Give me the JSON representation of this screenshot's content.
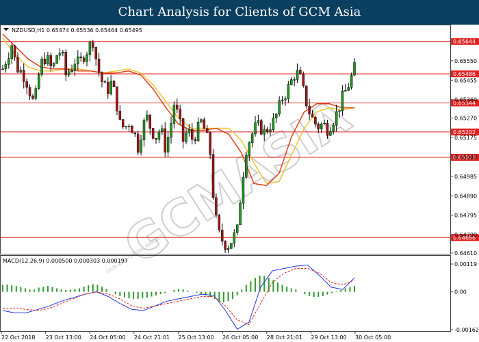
{
  "page": {
    "title": "Chart Analysis for Clients of GCM Asia"
  },
  "watermark": {
    "text": "GCMASIA",
    "sub": "GCM ASIA CAPITAL MARKETS"
  },
  "chart_data": {
    "type": "candlestick",
    "symbol": "NZDUSD,H1",
    "ohlc_header": {
      "open": "0.65474",
      "high": "0.65536",
      "low": "0.65464",
      "close": "0.65495"
    },
    "price_axis": {
      "ylim": [
        0.6461,
        0.6572
      ],
      "ticks": [
        "0.65550",
        "0.65455",
        "0.65360",
        "0.65270",
        "0.65175",
        "0.65080",
        "0.64985",
        "0.64890",
        "0.64795",
        "0.64700",
        "0.64610"
      ]
    },
    "levels": [
      {
        "value": 0.65644,
        "label": "0.65644",
        "color": "#e02020"
      },
      {
        "value": 0.65486,
        "label": "0.65486",
        "color": "#e02020"
      },
      {
        "value": 0.65344,
        "label": "0.65344",
        "color": "#e02020"
      },
      {
        "value": 0.65202,
        "label": "0.65202",
        "color": "#e02020"
      },
      {
        "value": 0.65078,
        "label": "0.65078",
        "color": "#e02020"
      },
      {
        "value": 0.64686,
        "label": "0.64686",
        "color": "#e02020"
      }
    ],
    "time_labels": [
      "22 Oct 2018",
      "23 Oct 13:00",
      "24 Oct 05:00",
      "24 Oct 21:01",
      "25 Oct 13:00",
      "26 Oct 05:00",
      "28 Oct 21:01",
      "29 Oct 13:00",
      "30 Oct 05:00"
    ],
    "close_path": [
      0.6551,
      0.6557,
      0.6563,
      0.6552,
      0.655,
      0.6547,
      0.654,
      0.6533,
      0.6548,
      0.6557,
      0.6555,
      0.655,
      0.6558,
      0.656,
      0.6548,
      0.6551,
      0.6555,
      0.6553,
      0.6558,
      0.6561,
      0.6565,
      0.6552,
      0.6545,
      0.654,
      0.6544,
      0.6538,
      0.6524,
      0.6522,
      0.6525,
      0.6521,
      0.6513,
      0.6523,
      0.6527,
      0.6521,
      0.6518,
      0.6522,
      0.6513,
      0.652,
      0.6534,
      0.6527,
      0.6516,
      0.6521,
      0.6517,
      0.652,
      0.6525,
      0.652,
      0.651,
      0.648,
      0.647,
      0.6466,
      0.6465,
      0.6468,
      0.6472,
      0.6495,
      0.6512,
      0.6518,
      0.6522,
      0.6523,
      0.652,
      0.6523,
      0.6525,
      0.653,
      0.6537,
      0.654,
      0.6545,
      0.655,
      0.6546,
      0.6537,
      0.653,
      0.6525,
      0.6523,
      0.6524,
      0.6522,
      0.6525,
      0.6529,
      0.6535,
      0.654,
      0.6545,
      0.6551
    ],
    "ma_fast_path": [
      0.6568,
      0.6562,
      0.6556,
      0.6552,
      0.6551,
      0.6551,
      0.655,
      0.655,
      0.6549,
      0.6549,
      0.655,
      0.6548,
      0.6541,
      0.6532,
      0.6524,
      0.6521,
      0.6521,
      0.6522,
      0.6519,
      0.651,
      0.6495,
      0.6494,
      0.65,
      0.6518,
      0.653,
      0.6534,
      0.6534,
      0.6532,
      0.6532
    ],
    "ma_slow_path": [
      0.6566,
      0.6558,
      0.6552,
      0.655,
      0.655,
      0.6551,
      0.6551,
      0.655,
      0.6549,
      0.655,
      0.6551,
      0.6549,
      0.6543,
      0.6535,
      0.6527,
      0.6522,
      0.6522,
      0.6522,
      0.6522,
      0.6516,
      0.6505,
      0.6495,
      0.6496,
      0.6509,
      0.6522,
      0.653,
      0.6532,
      0.6531,
      0.6532
    ],
    "macd": {
      "label": "MACD(12,26,9)",
      "values": [
        "0.000500",
        "0.000303",
        "0.000197"
      ],
      "ylim": [
        -0.00162,
        0.00119
      ],
      "ticks": [
        "0.00119",
        "0.00",
        "-0.00162"
      ],
      "histogram": [
        0.0003,
        0.00032,
        0.00028,
        0.00025,
        0.0002,
        0.00015,
        0.0001,
        0.0001,
        0.00018,
        0.00022,
        0.00025,
        0.0002,
        0.00015,
        0.0001,
        8e-05,
        0.0001,
        0.00012,
        0.00015,
        0.00022,
        0.00028,
        0.00033,
        0.0003,
        0.00022,
        0.00012,
        0.0,
        -0.0001,
        -0.00018,
        -0.00024,
        -0.00028,
        -0.0003,
        -0.0003,
        -0.00028,
        -0.00025,
        -0.0002,
        -0.00015,
        -0.0001,
        -5e-05,
        0.0,
        8e-05,
        0.00012,
        0.0001,
        5e-05,
        0.0,
        -5e-05,
        -0.0001,
        -0.00015,
        -0.00022,
        -0.0003,
        -0.0004,
        -0.00045,
        -0.0004,
        -0.0003,
        -0.00015,
        0.0001,
        0.0003,
        0.00045,
        0.0006,
        0.0007,
        0.00068,
        0.0006,
        0.0005,
        0.0004,
        0.0003,
        0.00022,
        0.00015,
        0.0001,
        0.0,
        -0.0001,
        -0.00018,
        -0.00022,
        -0.00022,
        -0.00018,
        -0.00012,
        -5e-05,
        2e-05,
        8e-05,
        0.00015,
        0.0002,
        0.00025
      ],
      "macd_path": [
        -0.0008,
        -0.0009,
        -0.0009,
        -0.00075,
        -0.0006,
        -0.0004,
        -0.00025,
        -0.0001,
        0.0,
        -0.0002,
        -0.0005,
        -0.00075,
        -0.0008,
        -0.0006,
        -0.0004,
        -0.0003,
        -0.0002,
        -0.0001,
        -0.00015,
        -0.0008,
        -0.0016,
        -0.0013,
        0.0002,
        0.0009,
        0.001,
        0.0011,
        0.00115,
        0.0007,
        0.0002,
        0.0001,
        0.0006
      ],
      "signal_path": [
        -0.0007,
        -0.0007,
        -0.00075,
        -0.0008,
        -0.0007,
        -0.0005,
        -0.0003,
        -0.0001,
        0.0,
        -0.0001,
        -0.0003,
        -0.0006,
        -0.0007,
        -0.0006,
        -0.0005,
        -0.0004,
        -0.0003,
        -0.0002,
        -0.0002,
        -0.0006,
        -0.0012,
        -0.0014,
        -0.0005,
        0.0004,
        0.0008,
        0.001,
        0.001,
        0.0008,
        0.0004,
        0.0003,
        0.0005
      ]
    }
  }
}
